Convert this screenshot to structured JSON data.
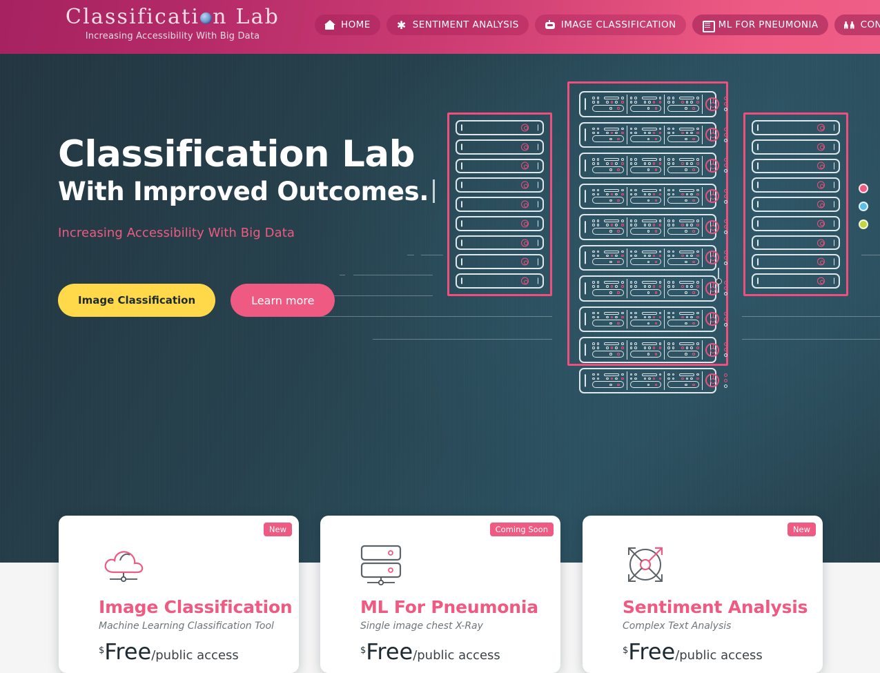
{
  "header": {
    "brand_title_pre": "Classificati",
    "brand_title_post": "n Lab",
    "brand_icon": "brain-sphere-icon",
    "brand_subtitle": "Increasing Accessibility With Big Data",
    "nav": [
      {
        "label": "HOME",
        "icon": "home-icon"
      },
      {
        "label": "SENTIMENT ANALYSIS",
        "icon": "asterisk-icon"
      },
      {
        "label": "IMAGE CLASSIFICATION",
        "icon": "robot-icon"
      },
      {
        "label": "ML FOR PNEUMONIA",
        "icon": "xray-icon"
      },
      {
        "label": "CONTACT",
        "icon": "contact-people-icon"
      }
    ]
  },
  "hero": {
    "headline": "Classification Lab",
    "subheadline": "With Improved Outcomes.",
    "tagline": "Increasing Accessibility With Big Data",
    "primary_button": "Image Classification",
    "secondary_button": "Learn more",
    "status_dots": [
      "#ef5a82",
      "#5bc0e8",
      "#c3d640"
    ]
  },
  "cards": [
    {
      "badge": "New",
      "icon": "cloud-network-icon",
      "title": "Image Classification",
      "subtitle": "Machine Learning Classification Tool",
      "currency": "$",
      "amount": "Free",
      "period": "/public access"
    },
    {
      "badge": "Coming Soon",
      "icon": "server-stack-icon",
      "title": "ML For Pneumonia",
      "subtitle": "Single image chest X-Ray",
      "currency": "$",
      "amount": "Free",
      "period": "/public access"
    },
    {
      "badge": "New",
      "icon": "expand-target-icon",
      "title": "Sentiment Analysis",
      "subtitle": "Complex Text Analysis",
      "currency": "$",
      "amount": "Free",
      "period": "/public access"
    }
  ],
  "colors": {
    "brand_pink": "#ef5a82",
    "brand_magenta": "#a62260",
    "accent_yellow": "#ffd949",
    "hero_dark": "#27434f",
    "light_band": "#f5f5f5"
  }
}
